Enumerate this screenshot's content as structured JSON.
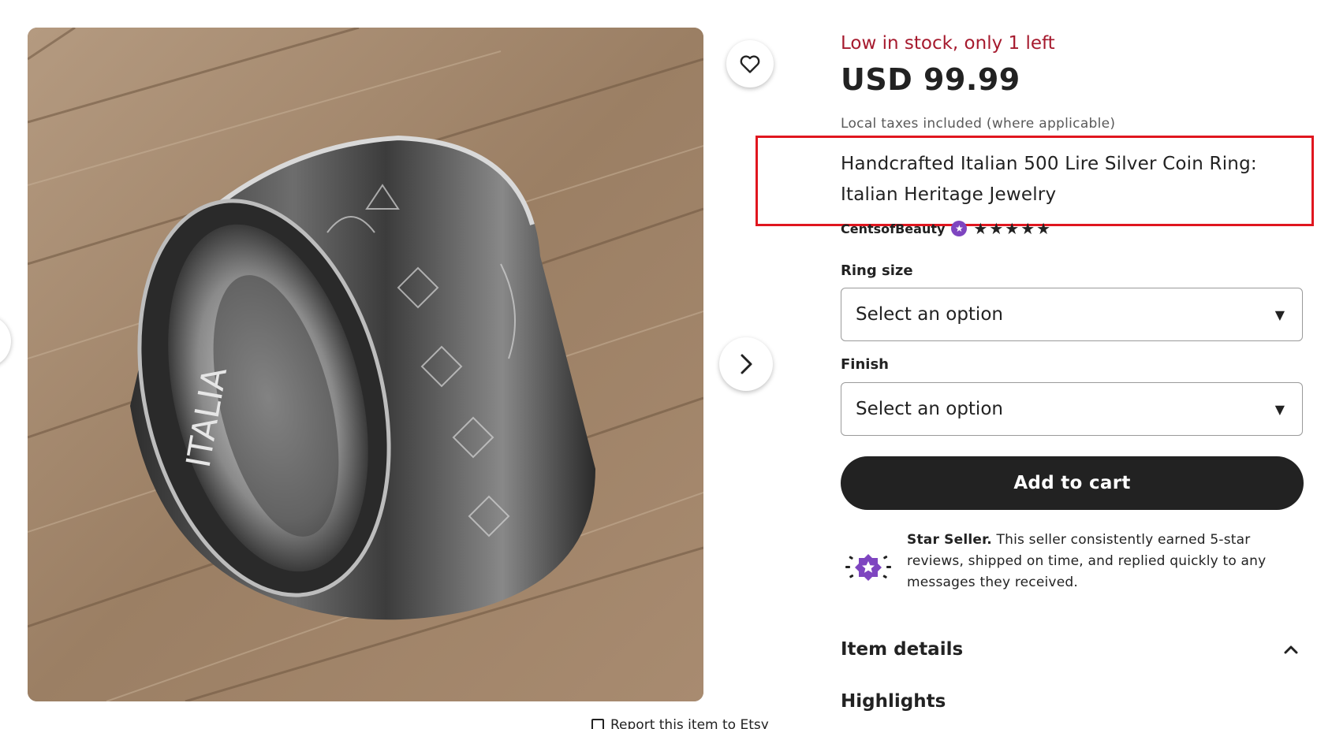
{
  "gallery": {
    "image_alt": "Silver coin ring on wooden table",
    "report_link": "Report this item to Etsy"
  },
  "listing": {
    "stock_notice": "Low in stock, only 1 left",
    "price": "USD 99.99",
    "tax_note": "Local taxes included (where applicable)",
    "title": "Handcrafted Italian 500 Lire Silver Coin Ring: Italian Heritage Jewelry",
    "seller_name": "CentsofBeauty",
    "rating_stars": "★★★★★",
    "rating_value": 5
  },
  "options": {
    "ring_size_label": "Ring size",
    "ring_size_value": "Select an option",
    "finish_label": "Finish",
    "finish_value": "Select an option"
  },
  "actions": {
    "add_to_cart": "Add to cart"
  },
  "star_seller": {
    "heading": "Star Seller.",
    "text": " This seller consistently earned 5-star reviews, shipped on time, and replied quickly to any messages they received."
  },
  "sections": {
    "item_details": "Item details",
    "highlights": "Highlights"
  },
  "colors": {
    "stock_red": "#a61a2e",
    "highlight_box": "#e0161f",
    "star_seller_purple": "#7e45c0",
    "button_dark": "#222222"
  }
}
